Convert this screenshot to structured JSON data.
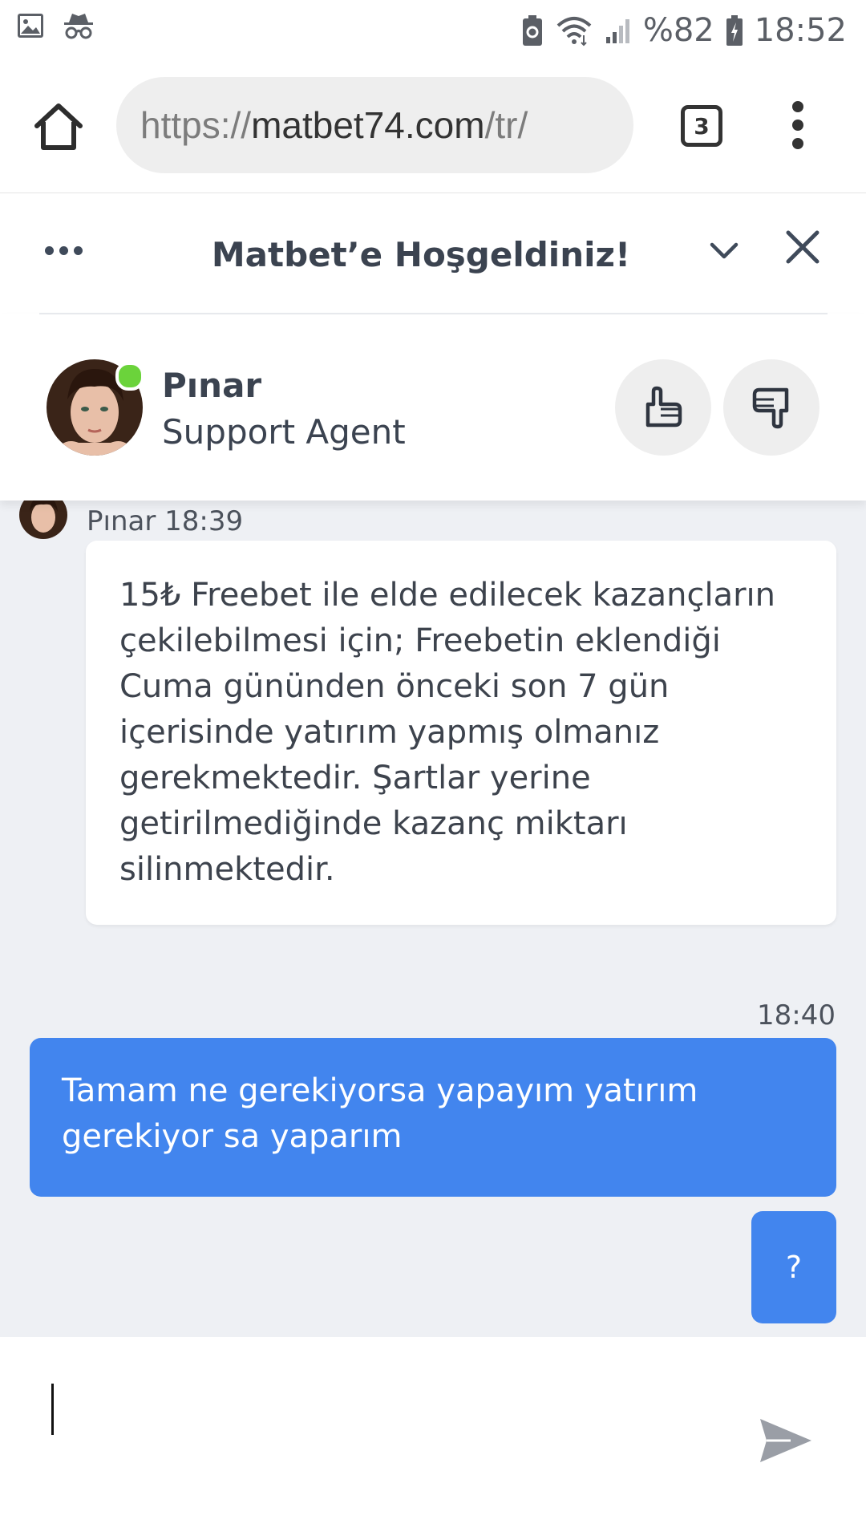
{
  "status_bar": {
    "battery": "%82",
    "time": "18:52",
    "icons": [
      "image-icon",
      "incognito-icon",
      "recycle-icon",
      "wifi-icon",
      "signal-icon",
      "battery-icon"
    ]
  },
  "browser": {
    "url_scheme": "https://",
    "url_host": "matbet74.com",
    "url_path": "/tr/",
    "tab_count": "3"
  },
  "chat": {
    "header_title": "Matbet’e Hoşgeldiniz!",
    "agent": {
      "name": "Pınar",
      "role": "Support Agent",
      "status_color": "#6bd33b"
    },
    "messages": [
      {
        "sender": "Pınar 18:39",
        "text": "15₺ Freebet ile elde edilecek kazançların çekilebilmesi için; Freebetin eklendiği Cuma gününden önceki son 7 gün içerisinde yatırım yapmış olmanız gerekmektedir.  Şartlar yerine getirilmediğinde kazanç miktarı silinmektedir."
      },
      {
        "time": "18:40",
        "text": "Tamam ne gerekiyorsa yapayım yatırım gerekiyor sa yaparım"
      },
      {
        "text": "?"
      }
    ],
    "colors": {
      "user_bubble": "#4285ee",
      "chat_background": "#eef0f4"
    }
  }
}
